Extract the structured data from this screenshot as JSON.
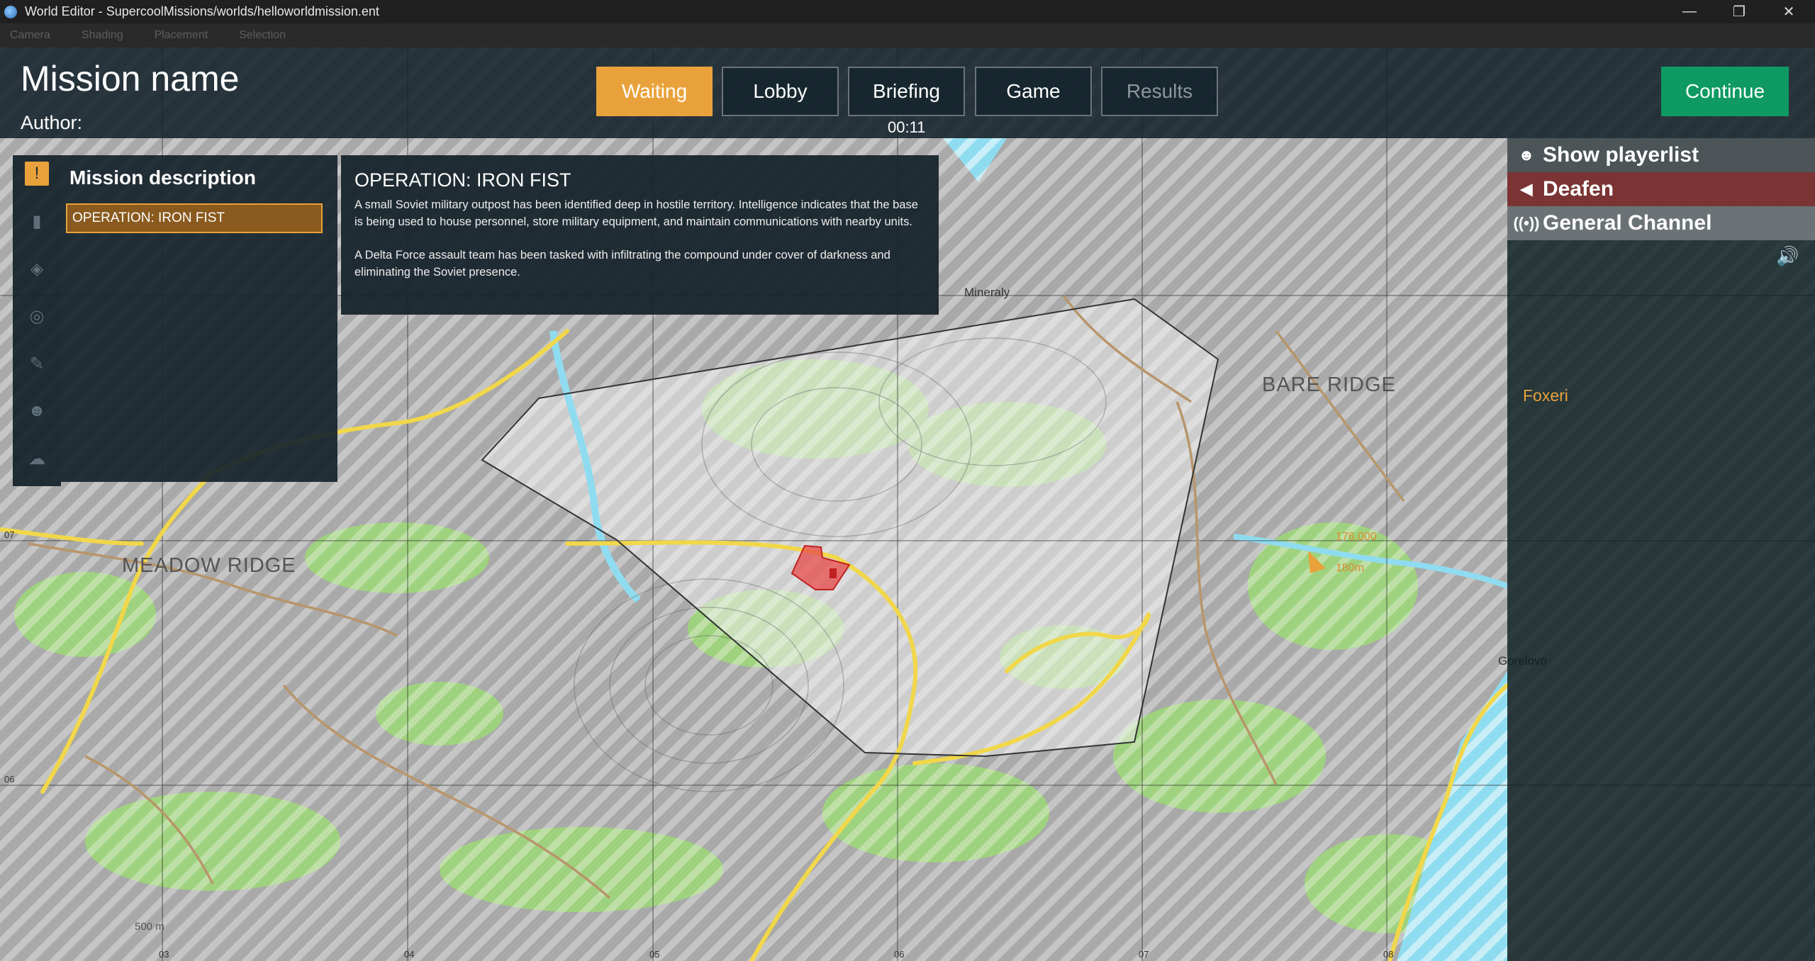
{
  "window": {
    "title": "World Editor - SupercoolMissions/worlds/helloworldmission.ent",
    "controls": [
      "—",
      "❐",
      "✕"
    ]
  },
  "menubar": [
    "Camera",
    "Shading",
    "Placement",
    "Selection"
  ],
  "header": {
    "mission_name": "Mission name",
    "author_label": "Author:",
    "timer": "00:11",
    "continue_label": "Continue"
  },
  "phases": [
    {
      "label": "Waiting",
      "state": "active"
    },
    {
      "label": "Lobby",
      "state": "normal"
    },
    {
      "label": "Briefing",
      "state": "normal"
    },
    {
      "label": "Game",
      "state": "normal"
    },
    {
      "label": "Results",
      "state": "disabled"
    }
  ],
  "left_rail": {
    "icons": [
      "exclamation-icon",
      "objective-icon",
      "compass-icon",
      "target-icon",
      "pencil-icon",
      "group-icon",
      "cloud-icon"
    ],
    "active_index": 0
  },
  "description_panel": {
    "title": "Mission description",
    "items": [
      "OPERATION: IRON FIST"
    ],
    "selected_index": 0
  },
  "briefing": {
    "title": "OPERATION: IRON FIST",
    "paragraphs": [
      "A small Soviet military outpost has been identified deep in hostile territory. Intelligence indicates that the base is being used to house personnel, store military equipment, and maintain communications with nearby units.",
      "A Delta Force assault team has been tasked with infiltrating the compound under cover of darkness and eliminating the Soviet presence."
    ]
  },
  "right_panel": {
    "show_playerlist": "Show playerlist",
    "deafen": "Deafen",
    "channel": "General Channel",
    "players": [
      "Foxeri"
    ]
  },
  "map": {
    "labels": [
      "MEADOW RIDGE",
      "BARE RIDGE",
      "Mineraly",
      "Gorelovo"
    ],
    "grid_numbers_top": [
      "03",
      "04",
      "05",
      "06",
      "07",
      "08"
    ],
    "grid_numbers_left": [
      "07",
      "06"
    ],
    "scale_label": "500 m",
    "marker_text": [
      "176,000",
      "180m"
    ],
    "colors": {
      "accent": "#e9a23b",
      "continue": "#0f9a63",
      "deafen": "#7a3434",
      "water": "#8fdcf0",
      "forest": "#9fd27e",
      "road": "#f1d74a",
      "objective": "#e84a4a"
    }
  }
}
